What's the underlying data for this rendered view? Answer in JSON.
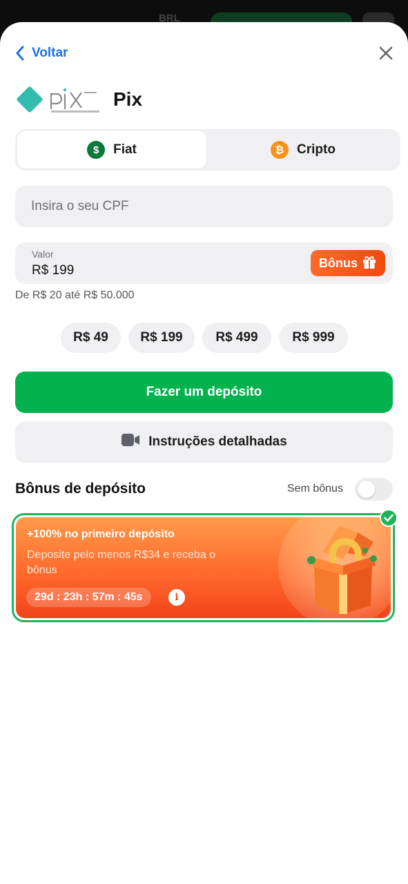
{
  "header": {
    "back_label": "Voltar"
  },
  "brand": {
    "logo_icon": "pix-logo",
    "title": "Pix"
  },
  "payment_tabs": [
    {
      "label": "Fiat",
      "icon": "dollar-coin-icon",
      "active": true
    },
    {
      "label": "Cripto",
      "icon": "bitcoin-icon",
      "active": false
    }
  ],
  "cpf_field": {
    "placeholder": "Insira o seu CPF",
    "value": ""
  },
  "amount_field": {
    "label": "Valor",
    "value": "R$ 199",
    "bonus_button": "Bônus"
  },
  "amount_range": "De R$ 20 até R$ 50.000",
  "quick_amounts": [
    "R$ 49",
    "R$ 199",
    "R$ 499",
    "R$ 999"
  ],
  "deposit_button": "Fazer um depósito",
  "instructions_button": "Instruções detalhadas",
  "bonus_section": {
    "title": "Bônus de depósito",
    "no_bonus_label": "Sem bônus",
    "no_bonus_enabled": false,
    "offer": {
      "title": "+100% no primeiro depósito",
      "description": "Deposite pelo menos R$34 e receba o bônus",
      "countdown": "29d : 23h : 57m : 45s",
      "selected": true
    }
  },
  "colors": {
    "accent_blue": "#1a73e8",
    "primary_green": "#03b24f",
    "bonus_orange": "#f04a10",
    "pix_teal": "#32bcad"
  },
  "background_app": {
    "currency": "BRL"
  }
}
